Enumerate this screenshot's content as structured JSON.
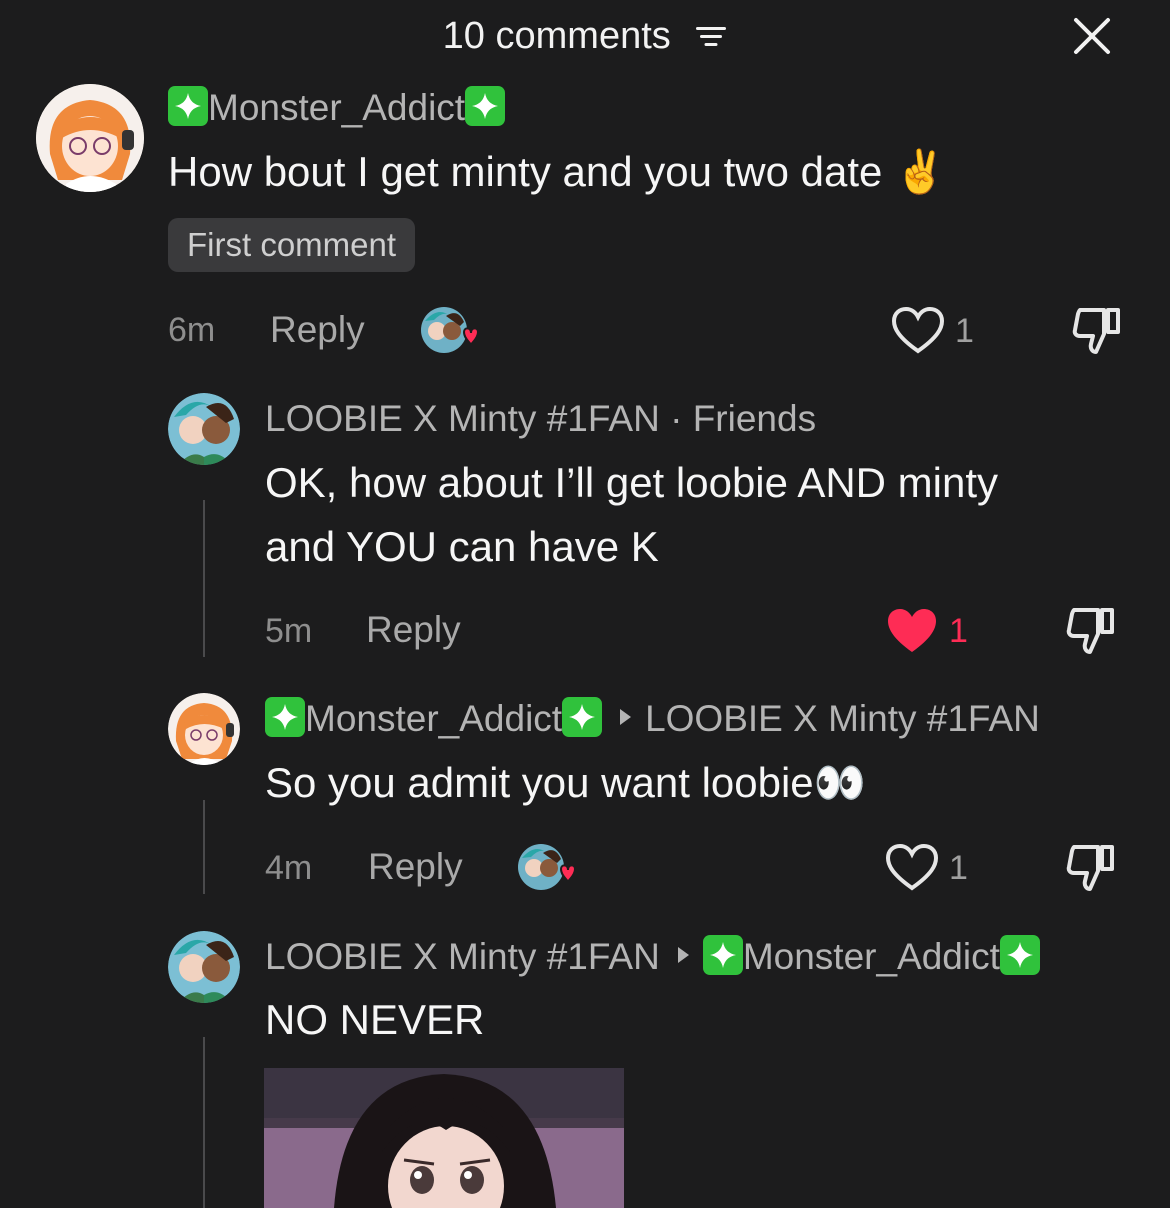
{
  "header": {
    "title": "10 comments"
  },
  "comments": [
    {
      "author": "Monster_Addict",
      "text": "How bout I get minty and you two date",
      "emoji": "✌️",
      "badge": "First comment",
      "time": "6m",
      "reply_label": "Reply",
      "likes": "1"
    },
    {
      "author": "LOOBIE X Minty #1FAN",
      "relation": "· Friends",
      "text_line1": "OK, how about I’ll get loobie AND minty",
      "text_line2": "and YOU can have K",
      "time": "5m",
      "reply_label": "Reply",
      "likes": "1",
      "liked": true
    },
    {
      "author": "Monster_Addict",
      "reply_to": "LOOBIE X Minty #1FAN",
      "text": "So you admit you want loobie",
      "emoji": "👀",
      "time": "4m",
      "reply_label": "Reply",
      "likes": "1"
    },
    {
      "author": "LOOBIE X Minty #1FAN",
      "reply_to": "Monster_Addict",
      "text": "NO NEVER"
    }
  ],
  "colors": {
    "background": "#1c1c1d",
    "liked": "#fe2c55",
    "sparkle_badge": "#30c23c"
  }
}
